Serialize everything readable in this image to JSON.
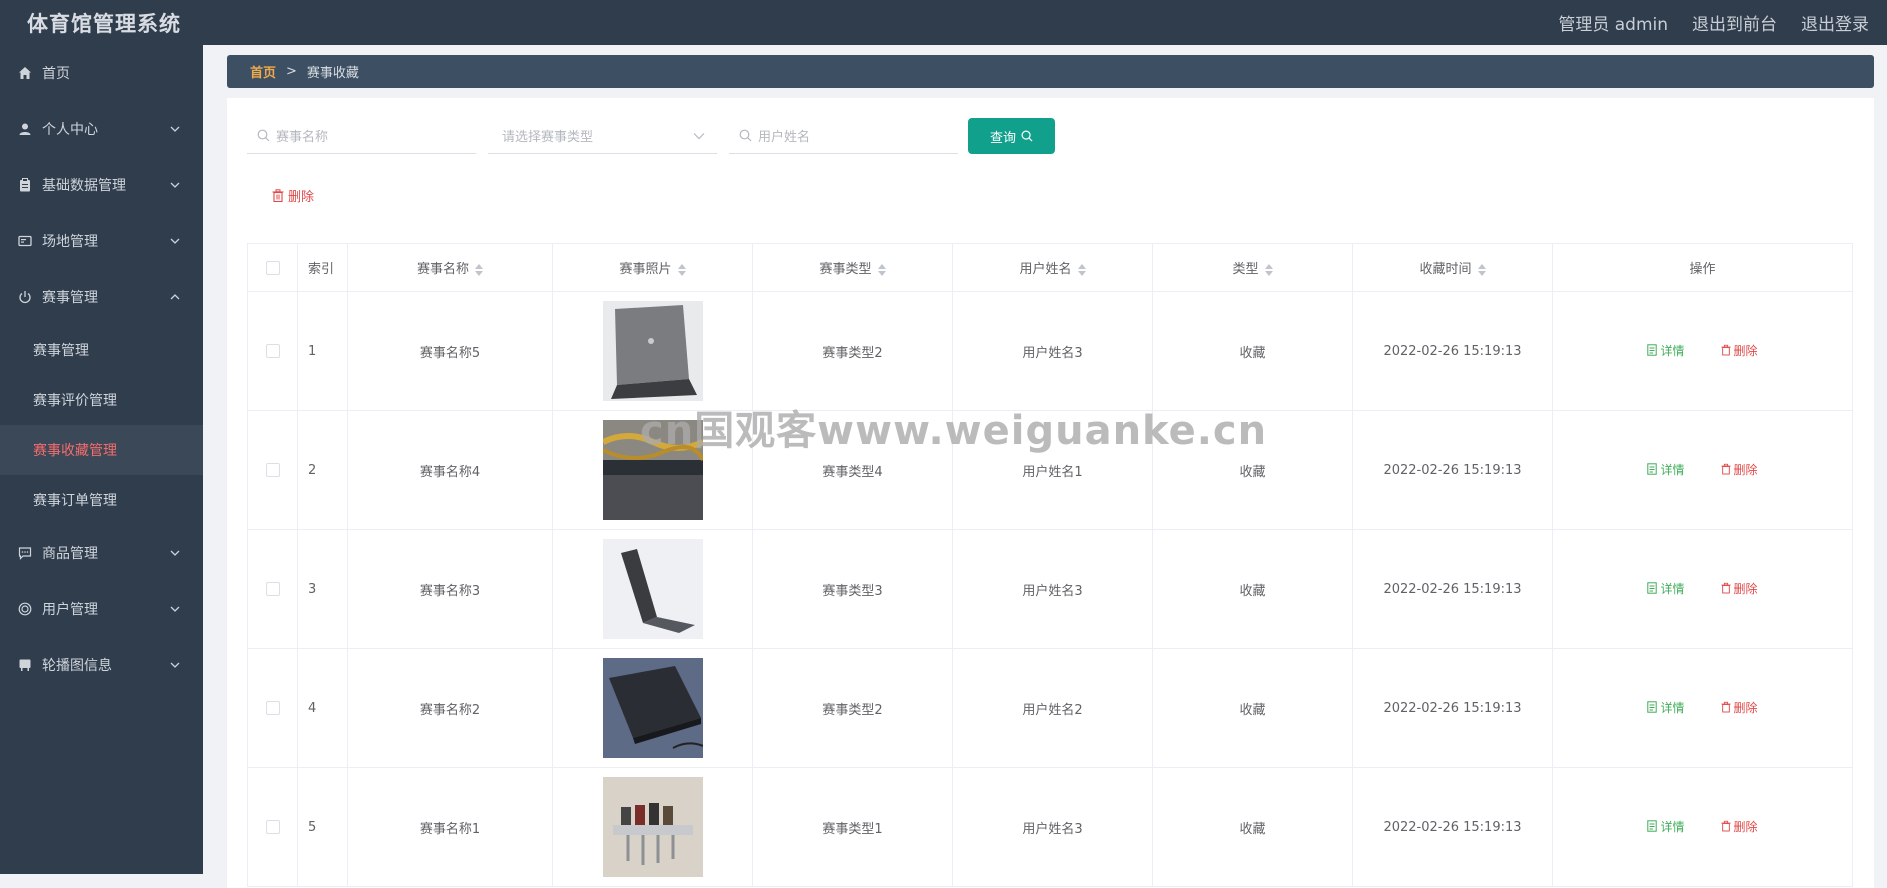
{
  "header": {
    "app_title": "体育馆管理系统",
    "user_label": "管理员 admin",
    "frontend_link": "退出到前台",
    "logout_link": "退出登录"
  },
  "sidebar": {
    "items": [
      {
        "label": "首页",
        "icon": "home-icon"
      },
      {
        "label": "个人中心",
        "icon": "user-icon"
      },
      {
        "label": "基础数据管理",
        "icon": "clipboard-icon"
      },
      {
        "label": "场地管理",
        "icon": "monitor-icon"
      },
      {
        "label": "赛事管理",
        "icon": "power-icon",
        "expanded": true,
        "children": [
          {
            "label": "赛事管理"
          },
          {
            "label": "赛事评价管理"
          },
          {
            "label": "赛事收藏管理",
            "active": true
          },
          {
            "label": "赛事订单管理"
          }
        ]
      },
      {
        "label": "商品管理",
        "icon": "chat-icon"
      },
      {
        "label": "用户管理",
        "icon": "ring-icon"
      },
      {
        "label": "轮播图信息",
        "icon": "board-icon"
      }
    ]
  },
  "breadcrumb": {
    "home": "首页",
    "separator": ">",
    "current": "赛事收藏"
  },
  "search": {
    "name_placeholder": "赛事名称",
    "type_placeholder": "请选择赛事类型",
    "user_placeholder": "用户姓名",
    "query_label": "查询"
  },
  "toolbar": {
    "delete_label": "删除"
  },
  "table": {
    "columns": [
      "索引",
      "赛事名称",
      "赛事照片",
      "赛事类型",
      "用户姓名",
      "类型",
      "收藏时间",
      "操作"
    ],
    "detail_label": "详情",
    "delete_label": "删除",
    "rows": [
      {
        "index": "1",
        "name": "赛事名称5",
        "photo": "laptop-back",
        "type": "赛事类型2",
        "user": "用户姓名3",
        "kind": "收藏",
        "time": "2022-02-26 15:19:13"
      },
      {
        "index": "2",
        "name": "赛事名称4",
        "photo": "gold-chain",
        "type": "赛事类型4",
        "user": "用户姓名1",
        "kind": "收藏",
        "time": "2022-02-26 15:19:13"
      },
      {
        "index": "3",
        "name": "赛事名称3",
        "photo": "laptop-side",
        "type": "赛事类型3",
        "user": "用户姓名3",
        "kind": "收藏",
        "time": "2022-02-26 15:19:13"
      },
      {
        "index": "4",
        "name": "赛事名称2",
        "photo": "laptop-closed",
        "type": "赛事类型2",
        "user": "用户姓名2",
        "kind": "收藏",
        "time": "2022-02-26 15:19:13"
      },
      {
        "index": "5",
        "name": "赛事名称1",
        "photo": "kitchen-rack",
        "type": "赛事类型1",
        "user": "用户姓名3",
        "kind": "收藏",
        "time": "2022-02-26 15:19:13"
      }
    ]
  },
  "watermark": "cn国观客www.weiguanke.cn",
  "colors": {
    "sidebar_bg": "#2f3d4c",
    "accent": "#10a08b",
    "danger": "#e04848",
    "active_menu": "#f56c6c",
    "breadcrumb_home": "#f0a94b"
  }
}
